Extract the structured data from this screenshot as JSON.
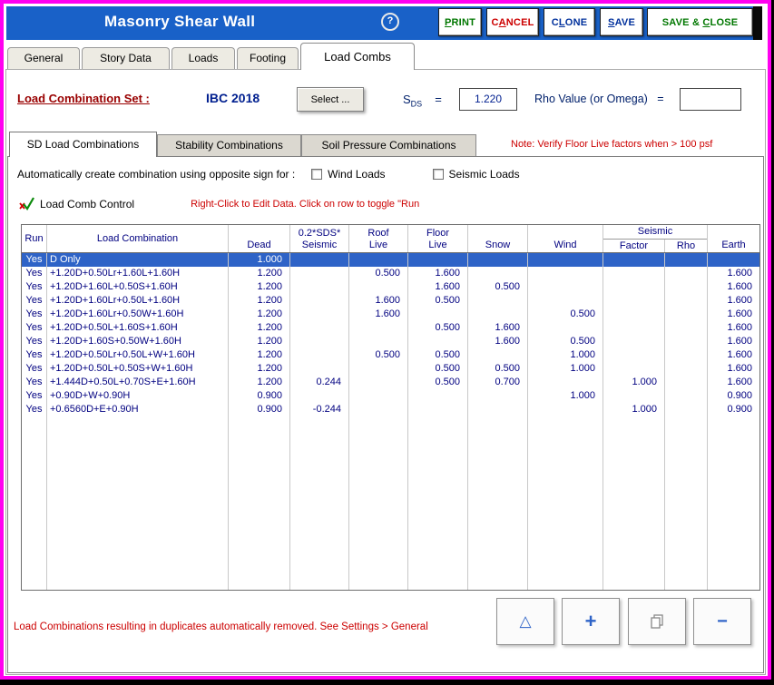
{
  "window": {
    "title": "Masonry Shear Wall",
    "help_glyph": "?"
  },
  "toolbar": {
    "buttons": [
      {
        "text": "PRINT",
        "accel": 0,
        "color": "#007700"
      },
      {
        "text": "CANCEL",
        "accel": 1,
        "color": "#CC0000"
      },
      {
        "text": "CLONE",
        "accel": 1,
        "color": "#00309C"
      },
      {
        "text": "SAVE",
        "accel": 0,
        "color": "#00309C"
      },
      {
        "text": "SAVE & CLOSE",
        "accel": 7,
        "color": "#007700"
      }
    ]
  },
  "tabs": {
    "items": [
      "General",
      "Story Data",
      "Loads",
      "Footing",
      "Load Combs"
    ],
    "active": "Load Combs"
  },
  "combo_set": {
    "label": "Load Combination Set :",
    "value": "IBC 2018",
    "select_button": "Select ...",
    "sds_symbol": "S",
    "sds_subscript": "DS",
    "equals": "=",
    "sds_value": "1.220",
    "rho_label": "Rho Value (or Omega)   =",
    "rho_value": ""
  },
  "subtabs": {
    "items": [
      "SD Load Combinations",
      "Stability Combinations",
      "Soil Pressure Combinations"
    ],
    "active": "SD Load Combinations"
  },
  "notes": {
    "floor_live": "Note: Verify Floor Live factors when > 100 psf",
    "edit_hint": "Right-Click to Edit Data. Click on row to toggle \"Run",
    "duplicates": "Load Combinations resulting in duplicates automatically removed. See Settings > General"
  },
  "auto_combo": {
    "label": "Automatically create combination using opposite sign for :",
    "wind_label": "Wind Loads",
    "wind_checked": false,
    "seismic_label": "Seismic Loads",
    "seismic_checked": false
  },
  "control": {
    "label": "Load Comb Control"
  },
  "grid": {
    "headers": {
      "run": "Run",
      "combo": "Load Combination",
      "dead": "Dead",
      "sds_line1": "0.2*SDS*",
      "sds_line2": "Seismic",
      "roof_line1": "Roof",
      "roof_line2": "Live",
      "floor_line1": "Floor",
      "floor_line2": "Live",
      "snow": "Snow",
      "wind": "Wind",
      "seismic_group": "Seismic",
      "factor": "Factor",
      "rho": "Rho",
      "earth": "Earth"
    },
    "selected_index": 0,
    "rows": [
      [
        "Yes",
        "D Only",
        "1.000",
        "",
        "",
        "",
        "",
        "",
        "",
        "",
        ""
      ],
      [
        "Yes",
        "+1.20D+0.50Lr+1.60L+1.60H",
        "1.200",
        "",
        "0.500",
        "1.600",
        "",
        "",
        "",
        "",
        "1.600"
      ],
      [
        "Yes",
        "+1.20D+1.60L+0.50S+1.60H",
        "1.200",
        "",
        "",
        "1.600",
        "0.500",
        "",
        "",
        "",
        "1.600"
      ],
      [
        "Yes",
        "+1.20D+1.60Lr+0.50L+1.60H",
        "1.200",
        "",
        "1.600",
        "0.500",
        "",
        "",
        "",
        "",
        "1.600"
      ],
      [
        "Yes",
        "+1.20D+1.60Lr+0.50W+1.60H",
        "1.200",
        "",
        "1.600",
        "",
        "",
        "0.500",
        "",
        "",
        "1.600"
      ],
      [
        "Yes",
        "+1.20D+0.50L+1.60S+1.60H",
        "1.200",
        "",
        "",
        "0.500",
        "1.600",
        "",
        "",
        "",
        "1.600"
      ],
      [
        "Yes",
        "+1.20D+1.60S+0.50W+1.60H",
        "1.200",
        "",
        "",
        "",
        "1.600",
        "0.500",
        "",
        "",
        "1.600"
      ],
      [
        "Yes",
        "+1.20D+0.50Lr+0.50L+W+1.60H",
        "1.200",
        "",
        "0.500",
        "0.500",
        "",
        "1.000",
        "",
        "",
        "1.600"
      ],
      [
        "Yes",
        "+1.20D+0.50L+0.50S+W+1.60H",
        "1.200",
        "",
        "",
        "0.500",
        "0.500",
        "1.000",
        "",
        "",
        "1.600"
      ],
      [
        "Yes",
        "+1.444D+0.50L+0.70S+E+1.60H",
        "1.200",
        "0.244",
        "",
        "0.500",
        "0.700",
        "",
        "1.000",
        "",
        "1.600"
      ],
      [
        "Yes",
        "+0.90D+W+0.90H",
        "0.900",
        "",
        "",
        "",
        "",
        "1.000",
        "",
        "",
        "0.900"
      ],
      [
        "Yes",
        "+0.6560D+E+0.90H",
        "0.900",
        "-0.244",
        "",
        "",
        "",
        "",
        "1.000",
        "",
        "0.900"
      ]
    ]
  },
  "action_buttons": {
    "up": "△",
    "add": "+",
    "remove": "−"
  }
}
